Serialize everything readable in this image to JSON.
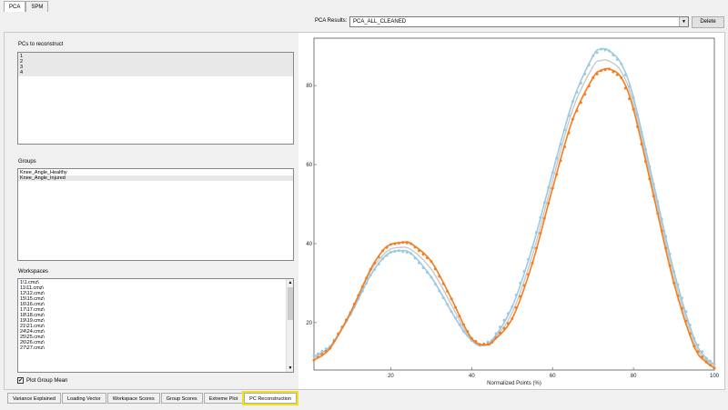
{
  "top_tabs": [
    {
      "label": "PCA",
      "active": true
    },
    {
      "label": "SPM",
      "active": false
    }
  ],
  "pca_results": {
    "label": "PCA Results:",
    "selected": "PCA_ALL_CLEANED",
    "delete_label": "Delete"
  },
  "pcs_section": {
    "label": "PCs to reconstruct",
    "items": [
      "1",
      "2",
      "3",
      "4"
    ]
  },
  "groups_section": {
    "label": "Groups",
    "items": [
      "Knee_Angle_Healthy",
      "Knee_Angle_Injured"
    ]
  },
  "workspaces_section": {
    "label": "Workspaces",
    "items": [
      "1\\1.cmz\\",
      "11\\11.cmz\\",
      "12\\12.cmz\\",
      "15\\15.cmz\\",
      "16\\16.cmz\\",
      "17\\17.cmz\\",
      "18\\18.cmz\\",
      "19\\19.cmz\\",
      "21\\21.cmz\\",
      "24\\24.cmz\\",
      "25\\25.cmz\\",
      "26\\26.cmz\\",
      "27\\27.cmz\\"
    ]
  },
  "plot_group_mean": {
    "label": "Plot Group Mean",
    "checked": true
  },
  "bottom_tabs": [
    {
      "label": "Variance Explained",
      "active": false
    },
    {
      "label": "Loading Vector",
      "active": false
    },
    {
      "label": "Workspace Scores",
      "active": false
    },
    {
      "label": "Group Scores",
      "active": false
    },
    {
      "label": "Extreme Plot",
      "active": false
    },
    {
      "label": "PC Reconstruction",
      "active": true
    }
  ],
  "chart_data": {
    "type": "line",
    "xlabel": "Normalized Points (%)",
    "ylabel": "",
    "xlim": [
      1,
      100
    ],
    "ylim": [
      8,
      92
    ],
    "xticks": [
      20,
      40,
      60,
      80,
      100
    ],
    "yticks": [
      20,
      40,
      60,
      80
    ],
    "grid": false,
    "series_colors": [
      "#9cc9e2",
      "#f47d20",
      "#c9c9c9"
    ],
    "series": [
      {
        "marker": "circle",
        "x": [
          1,
          5,
          10,
          15,
          18,
          20,
          22,
          25,
          30,
          35,
          38,
          40,
          42,
          45,
          50,
          55,
          60,
          65,
          70,
          72,
          74,
          77,
          80,
          85,
          90,
          95,
          98,
          100
        ],
        "y": [
          11.5,
          14,
          22,
          32,
          36.2,
          37.8,
          38.2,
          37.5,
          31.5,
          22.8,
          17.8,
          15.5,
          14.2,
          15.5,
          24,
          39,
          58,
          76,
          87.5,
          89.2,
          88.8,
          85.5,
          77,
          55,
          33,
          16,
          11,
          9.5
        ]
      },
      {
        "marker": "circle",
        "x": [
          1,
          5,
          10,
          15,
          18,
          20,
          23,
          25,
          30,
          35,
          38,
          40,
          42,
          44,
          45,
          50,
          55,
          60,
          65,
          70,
          72,
          74,
          77,
          80,
          85,
          90,
          95,
          98,
          100
        ],
        "y": [
          10.5,
          13.5,
          22.5,
          33.5,
          38.2,
          39.8,
          40.3,
          40,
          35.5,
          26,
          19.5,
          16,
          14.5,
          14.5,
          15,
          21,
          35,
          54,
          71.5,
          82,
          83.8,
          84.2,
          82,
          74,
          52,
          30,
          14,
          10,
          8.5
        ]
      },
      {
        "marker": "none",
        "x": [
          1,
          5,
          10,
          15,
          18,
          20,
          22,
          25,
          30,
          35,
          38,
          40,
          42,
          45,
          50,
          55,
          60,
          65,
          70,
          72,
          74,
          77,
          80,
          85,
          90,
          95,
          98,
          100
        ],
        "y": [
          11,
          14,
          22.5,
          33,
          37,
          38.6,
          39,
          38.5,
          33.5,
          24.5,
          18.6,
          15.8,
          14.3,
          15.2,
          22.5,
          37,
          56,
          74,
          84.8,
          86.3,
          86.2,
          83.5,
          75.5,
          53.5,
          31.5,
          15,
          10.5,
          9
        ]
      }
    ]
  }
}
